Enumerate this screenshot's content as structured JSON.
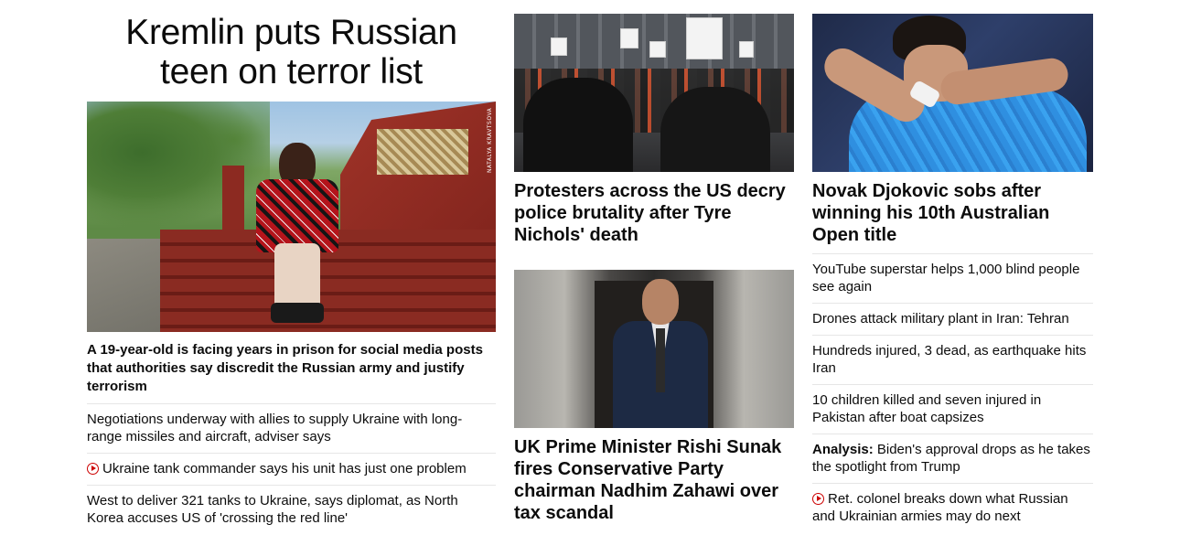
{
  "lead": {
    "title": "Kremlin puts Russian teen on terror list",
    "image_credit": "NATALYA KRAVTSOVA",
    "description": "A 19-year-old is facing years in prison for social media posts that authorities say discredit the Russian army and justify terrorism"
  },
  "left_links": [
    {
      "text": "Negotiations underway with allies to supply Ukraine with long-range missiles and aircraft, adviser says",
      "video": false
    },
    {
      "text": "Ukraine tank commander says his unit has just one problem",
      "video": true
    },
    {
      "text": "West to deliver 321 tanks to Ukraine, says diplomat, as North Korea accuses US of 'crossing the red line'",
      "video": false
    }
  ],
  "middle": {
    "story1_headline": "Protesters across the US decry police brutality after Tyre Nichols' death",
    "story2_headline": "UK Prime Minister Rishi Sunak fires Conservative Party chairman Nadhim Zahawi over tax scandal"
  },
  "right": {
    "headline": "Novak Djokovic sobs after winning his 10th Australian Open title",
    "links": [
      {
        "text": "YouTube superstar helps 1,000 blind people see again"
      },
      {
        "text": "Drones attack military plant in Iran: Tehran"
      },
      {
        "text": "Hundreds injured, 3 dead, as earthquake hits Iran"
      },
      {
        "text": "10 children killed and seven injured in Pakistan after boat capsizes"
      },
      {
        "prefix": "Analysis:",
        "text": " Biden's approval drops as he takes the spotlight from Trump"
      },
      {
        "text": "Ret. colonel breaks down what Russian and Ukrainian armies may do next",
        "video": true
      }
    ]
  },
  "colors": {
    "accent_red": "#cc0000",
    "text": "#0c0c0c",
    "divider": "#e6e6e6"
  },
  "icons": {
    "video": "play-circle-icon"
  }
}
